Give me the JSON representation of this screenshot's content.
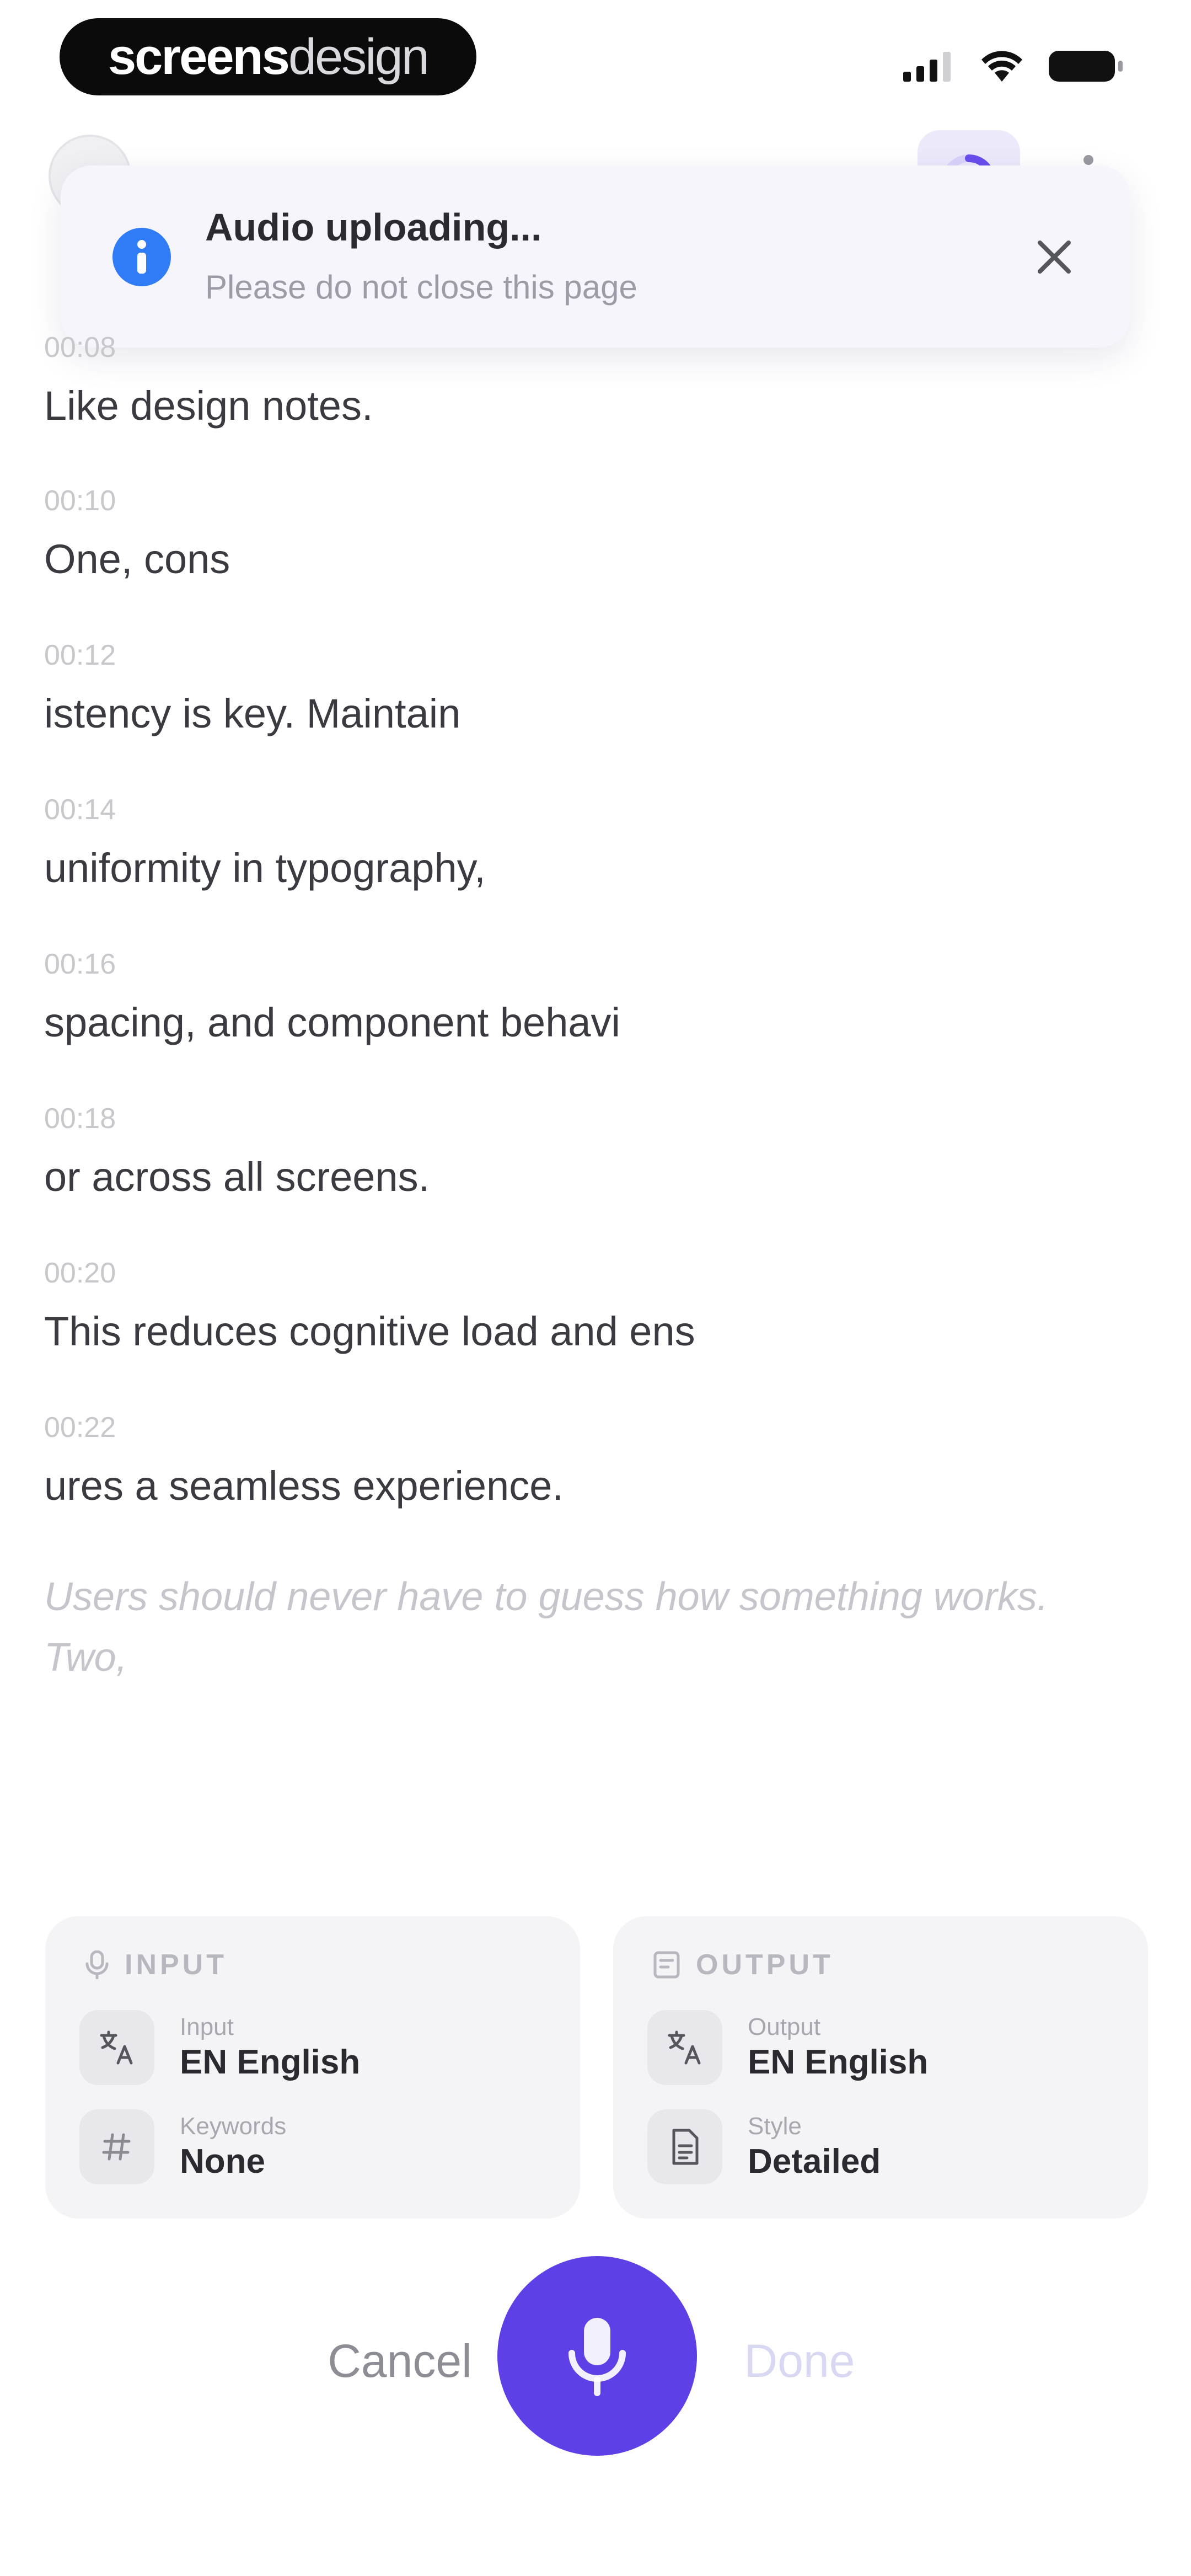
{
  "status_bar": {
    "brand_bold": "screens",
    "brand_light": "design",
    "icons": [
      "signal-icon",
      "wifi-icon",
      "battery-icon"
    ]
  },
  "toast": {
    "title": "Audio uploading...",
    "subtitle": "Please do not close this page",
    "icon": "info-icon",
    "accent": "#2f7cf6"
  },
  "transcript": {
    "lines": [
      {
        "time": "00:08",
        "text": "Like design notes."
      },
      {
        "time": "00:10",
        "text": "One, cons"
      },
      {
        "time": "00:12",
        "text": "istency is key. Maintain"
      },
      {
        "time": "00:14",
        "text": "uniformity in typography,"
      },
      {
        "time": "00:16",
        "text": "spacing, and component behavi"
      },
      {
        "time": "00:18",
        "text": "or across all screens."
      },
      {
        "time": "00:20",
        "text": "This reduces cognitive load and ens"
      },
      {
        "time": "00:22",
        "text": "ures a seamless experience."
      }
    ],
    "live_text": " Users should never have to guess how something works. Two,"
  },
  "input_card": {
    "header": "INPUT",
    "rows": [
      {
        "label": "Input",
        "value": "EN English",
        "icon": "translate-icon"
      },
      {
        "label": "Keywords",
        "value": "None",
        "icon": "hash-icon"
      }
    ]
  },
  "output_card": {
    "header": "OUTPUT",
    "rows": [
      {
        "label": "Output",
        "value": "EN English",
        "icon": "translate-icon"
      },
      {
        "label": "Style",
        "value": "Detailed",
        "icon": "document-icon"
      }
    ]
  },
  "controls": {
    "cancel_label": "Cancel",
    "done_label": "Done",
    "mic_icon": "microphone-icon"
  },
  "colors": {
    "accent": "#5f3fe6",
    "toast_bg": "#f6f5fb",
    "card_bg": "#f4f4f6",
    "muted_text": "#c7c7cc"
  }
}
